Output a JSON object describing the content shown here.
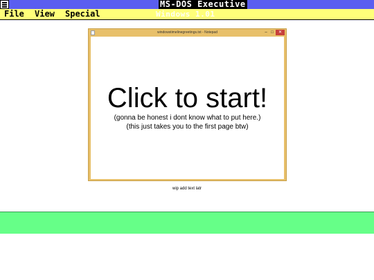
{
  "titlebar": {
    "title": "MS-DOS Executive",
    "ghost_text": "Windows 1.01"
  },
  "menu": {
    "file": "File",
    "view": "View",
    "special": "Special"
  },
  "notepad": {
    "window_title": "windowstimelinegreetings.txt - Notepad",
    "min_glyph": "–",
    "max_glyph": "□",
    "close_glyph": "✕",
    "heading": "Click to start!",
    "line1": "(gonna be honest i dont know what to put here.)",
    "line2": "(this just takes you to the first page btw)"
  },
  "footer_note": "wip add text latr",
  "colors": {
    "titlebar": "#5a5ef0",
    "menubar": "#ffff7a",
    "window_border": "#e8c06a",
    "green_band": "#66ff88"
  }
}
